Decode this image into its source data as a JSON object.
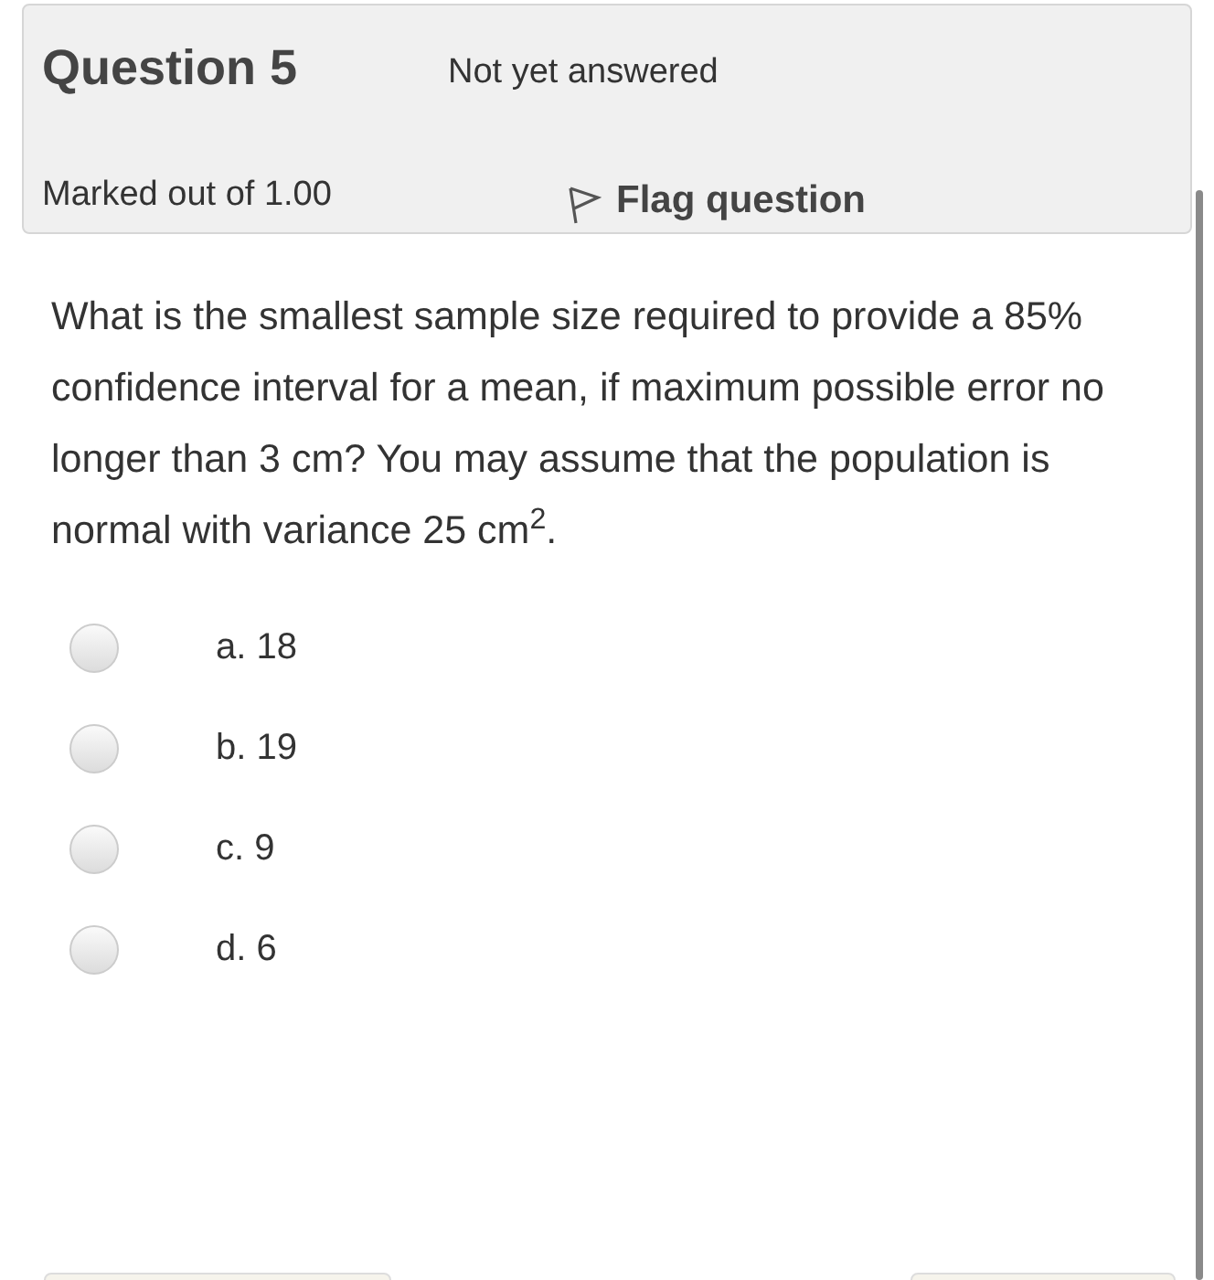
{
  "info": {
    "title": "Question 5",
    "status": "Not yet answered",
    "marks": "Marked out of 1.00",
    "flag": {
      "label": "Flag question",
      "flagged": false
    }
  },
  "question": {
    "text": "What is the smallest sample size required to provide a 85% confidence interval for a mean, if maximum possible error no longer than 3 cm? You may assume that the population is normal with variance 25 cm$^{2}$."
  },
  "options": [
    {
      "label": "a. 18",
      "selected": false
    },
    {
      "label": "b. 19",
      "selected": false
    },
    {
      "label": "c. 9",
      "selected": false
    },
    {
      "label": "d. 6",
      "selected": false
    }
  ]
}
